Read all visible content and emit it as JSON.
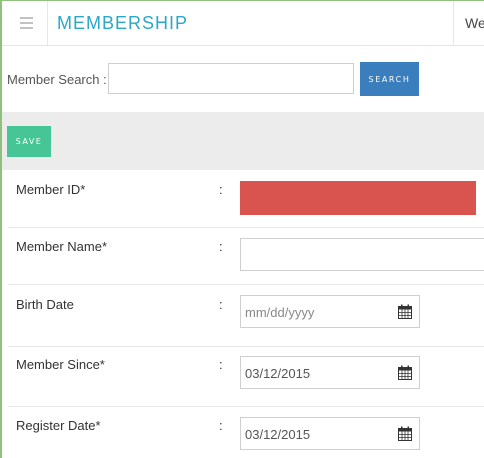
{
  "header": {
    "title": "MEMBERSHIP",
    "welcome": "We"
  },
  "search": {
    "label": "Member Search :",
    "value": "",
    "button": "SEARCH"
  },
  "toolbar": {
    "save": "SAVE"
  },
  "form": {
    "fields": [
      {
        "label": "Member ID*",
        "colon": ":",
        "value": "",
        "state": "error"
      },
      {
        "label": "Member Name*",
        "colon": ":",
        "value": ""
      },
      {
        "label": "Birth Date",
        "colon": ":",
        "placeholder": "mm/dd/yyyy"
      },
      {
        "label": "Member Since*",
        "colon": ":",
        "value": "03/12/2015"
      },
      {
        "label": "Register Date*",
        "colon": ":",
        "value": "03/12/2015"
      }
    ]
  },
  "colors": {
    "accent": "#2aa7c9",
    "search_button": "#3a7ebd",
    "save_button": "#46c696",
    "error": "#d9534f"
  },
  "icons": {
    "menu": "menu-icon",
    "calendar": "calendar-icon"
  }
}
